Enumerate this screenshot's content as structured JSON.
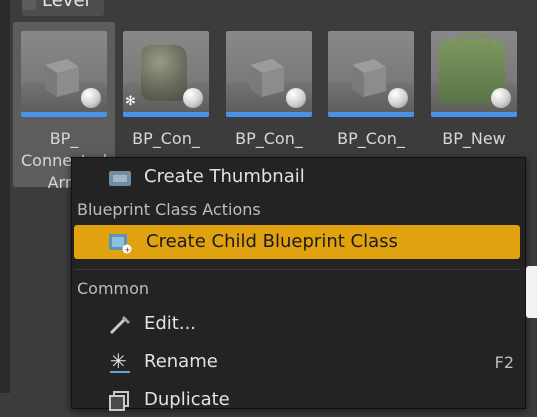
{
  "folder": {
    "label": "Level"
  },
  "assets": [
    {
      "name_line1": "BP_",
      "name_line2": "Connected",
      "name_line3": "Arm"
    },
    {
      "name": "BP_Con_"
    },
    {
      "name": "BP_Con_"
    },
    {
      "name": "BP_Con_"
    },
    {
      "name": "BP_New"
    }
  ],
  "context_menu": {
    "top_item": {
      "label": "Create Thumbnail",
      "icon": "thumbnail-icon"
    },
    "sections": [
      {
        "header": "Blueprint Class Actions",
        "items": [
          {
            "label": "Create Child Blueprint Class",
            "icon": "child-blueprint-icon",
            "highlighted": true
          }
        ]
      },
      {
        "header": "Common",
        "items": [
          {
            "label": "Edit...",
            "icon": "edit-icon"
          },
          {
            "label": "Rename",
            "icon": "rename-icon",
            "shortcut": "F2"
          },
          {
            "label": "Duplicate",
            "icon": "duplicate-icon"
          }
        ]
      }
    ]
  },
  "colors": {
    "highlight": "#e0a20f",
    "selection_bar": "#4a92e8",
    "menu_bg": "#232323"
  }
}
